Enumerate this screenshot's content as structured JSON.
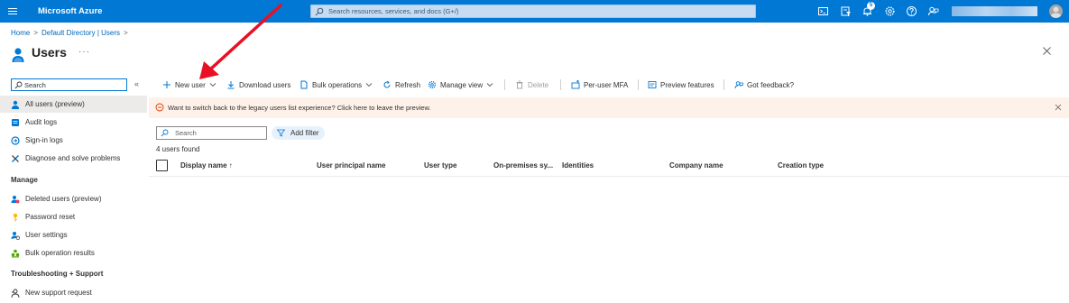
{
  "topbar": {
    "brand": "Microsoft Azure",
    "search_placeholder": "Search resources, services, and docs (G+/)",
    "notification_count": "5",
    "icons": [
      "cloud-shell-icon",
      "directory-filter-icon",
      "notifications-icon",
      "settings-icon",
      "help-icon",
      "feedback-icon"
    ],
    "accent": "#0078d4"
  },
  "breadcrumb": {
    "items": [
      "Home",
      "Default Directory | Users"
    ]
  },
  "page": {
    "title": "Users",
    "more": "···"
  },
  "sidebar": {
    "search_value": "Search",
    "items": [
      {
        "label": "All users (preview)",
        "icon": "user-icon"
      },
      {
        "label": "Audit logs",
        "icon": "audit-log-icon"
      },
      {
        "label": "Sign-in logs",
        "icon": "sign-in-log-icon"
      },
      {
        "label": "Diagnose and solve problems",
        "icon": "wrench-icon"
      }
    ],
    "manage_heading": "Manage",
    "manage_items": [
      {
        "label": "Deleted users (preview)",
        "icon": "deleted-users-icon"
      },
      {
        "label": "Password reset",
        "icon": "key-icon"
      },
      {
        "label": "User settings",
        "icon": "user-settings-icon"
      },
      {
        "label": "Bulk operation results",
        "icon": "bulk-results-icon"
      }
    ],
    "support_heading": "Troubleshooting + Support",
    "support_items": [
      {
        "label": "New support request",
        "icon": "support-person-icon"
      }
    ]
  },
  "toolbar": {
    "new_user": "New user",
    "download_users": "Download users",
    "bulk_operations": "Bulk operations",
    "refresh": "Refresh",
    "manage_view": "Manage view",
    "delete": "Delete",
    "per_user_mfa": "Per-user MFA",
    "preview_features": "Preview features",
    "got_feedback": "Got feedback?"
  },
  "banner": {
    "text": "Want to switch back to the legacy users list experience? Click here to leave the preview."
  },
  "list": {
    "search_placeholder": "Search",
    "add_filter": "Add filter",
    "count": "4 users found",
    "columns": [
      "Display name ↑",
      "User principal name",
      "User type",
      "On-premises sy...",
      "Identities",
      "Company name",
      "Creation type"
    ]
  }
}
